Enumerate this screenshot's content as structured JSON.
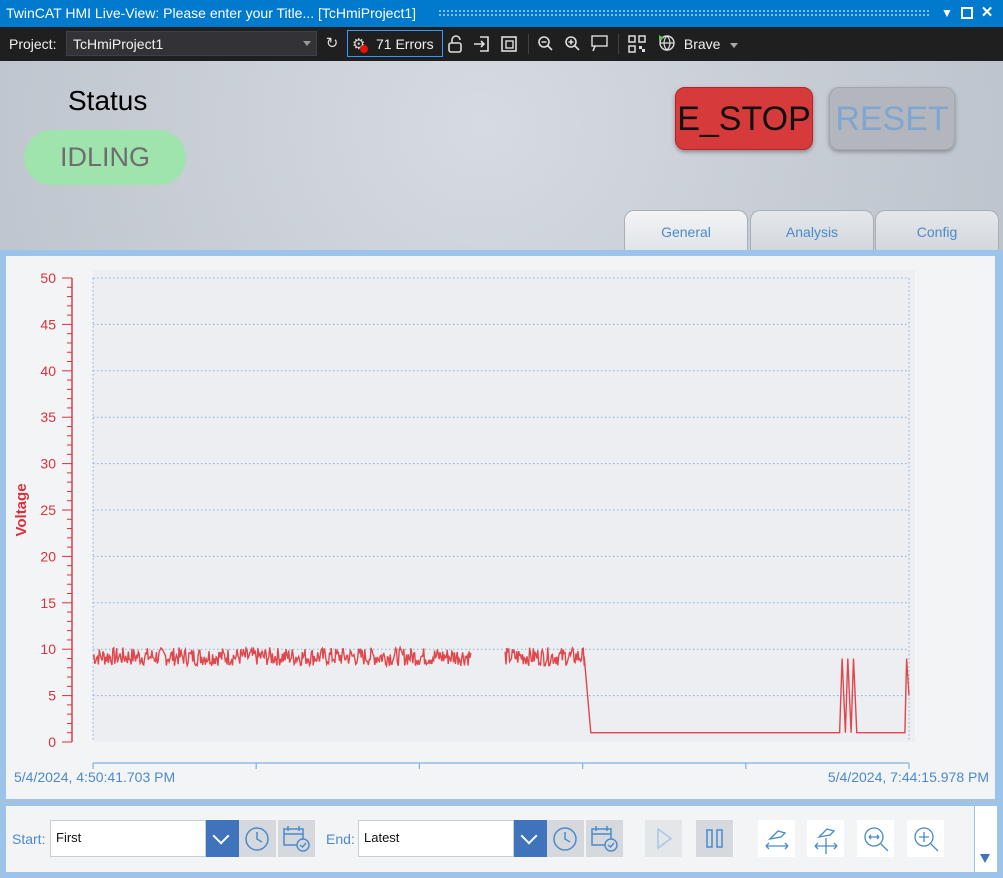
{
  "window": {
    "title": "TwinCAT HMI Live-View: Please enter your Title... [TcHmiProject1]",
    "buttons": [
      "chevron-down-icon",
      "maximize-icon",
      "close-icon"
    ]
  },
  "toolbar": {
    "project_label": "Project:",
    "project_value": "TcHmiProject1",
    "errors_label": "71 Errors",
    "browser_label": "Brave"
  },
  "hmi": {
    "status_title": "Status",
    "status_value": "IDLING",
    "estop_label": "E_STOP",
    "reset_label": "RESET",
    "tabs": [
      {
        "label": "General"
      },
      {
        "label": "Analysis"
      },
      {
        "label": "Config"
      }
    ],
    "colors": {
      "status_bg": "#9fe3ad",
      "estop_bg": "#d63a3a",
      "reset_bg": "#b3b7bd",
      "accent": "#4a8acb",
      "series": "#e0474c"
    }
  },
  "chart_data": {
    "type": "line",
    "ylabel": "Voltage",
    "ylim": [
      0,
      50
    ],
    "yticks": [
      0,
      5,
      10,
      15,
      20,
      25,
      30,
      35,
      40,
      45,
      50
    ],
    "x_start_label": "5/4/2024, 4:50:41.703 PM",
    "x_end_label": "5/4/2024, 7:44:15.978 PM",
    "grid": true,
    "x_range_fraction": [
      0,
      1
    ],
    "series": [
      {
        "segments": [
          {
            "x_from": 0.0,
            "x_to": 0.463,
            "kind": "noise",
            "center": 9.2,
            "amplitude": 1.0
          },
          {
            "x_from": 0.505,
            "x_to": 0.602,
            "kind": "noise",
            "center": 9.2,
            "amplitude": 1.0
          },
          {
            "kind": "points",
            "points": [
              [
                0.602,
                9.2
              ],
              [
                0.61,
                1.0
              ],
              [
                0.915,
                1.0
              ],
              [
                0.918,
                9.0
              ],
              [
                0.922,
                1.0
              ],
              [
                0.925,
                9.0
              ],
              [
                0.929,
                1.0
              ],
              [
                0.932,
                9.0
              ],
              [
                0.936,
                1.0
              ],
              [
                0.995,
                1.0
              ],
              [
                0.997,
                9.0
              ],
              [
                1.0,
                5.0
              ]
            ]
          }
        ]
      }
    ]
  },
  "controls": {
    "start_label": "Start:",
    "start_value": "First",
    "end_label": "End:",
    "end_value": "Latest"
  }
}
